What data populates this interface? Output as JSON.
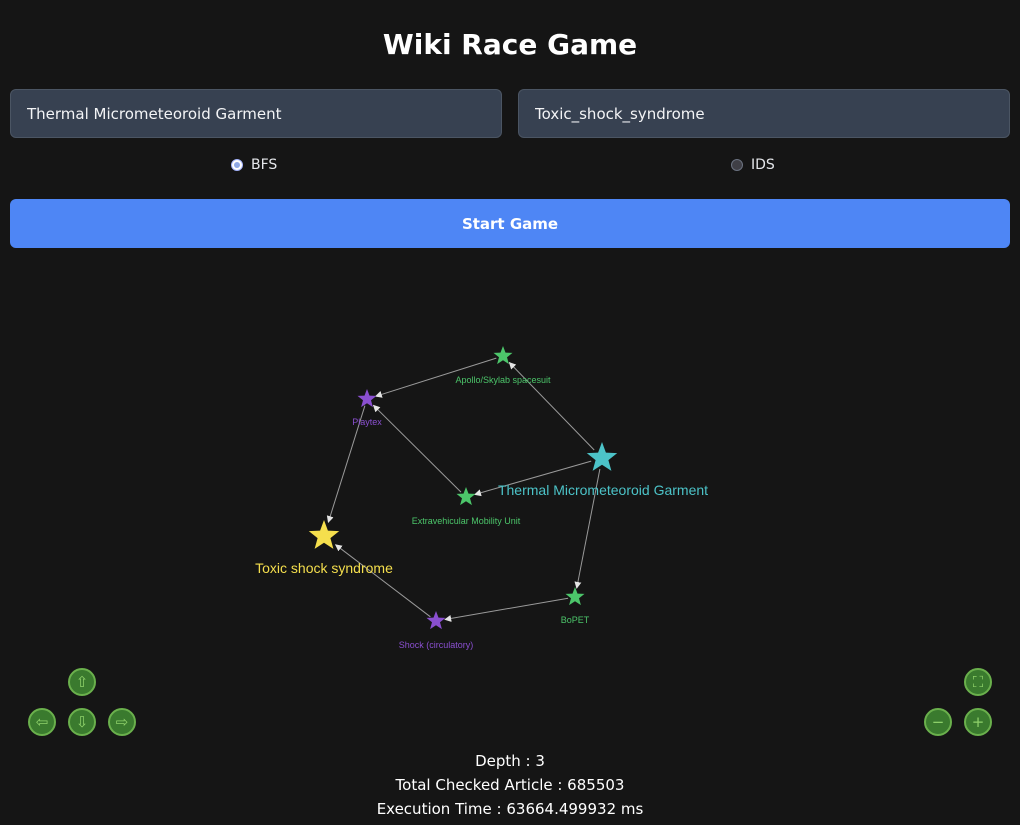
{
  "title": "Wiki Race Game",
  "inputs": {
    "start": "Thermal Micrometeoroid Garment",
    "target": "Toxic_shock_syndrome"
  },
  "algorithms": [
    {
      "label": "BFS",
      "checked": true
    },
    {
      "label": "IDS",
      "checked": false
    }
  ],
  "start_button": "Start Game",
  "graph": {
    "colors": {
      "start": "#4cc3c8",
      "target": "#f5df4d",
      "green": "#4cc56a",
      "purple": "#8a4fd0",
      "edge": "#9a9a9a"
    },
    "nodes": [
      {
        "id": "tmg",
        "label": "Thermal Micrometeoroid Garment",
        "color": "start",
        "size": "large"
      },
      {
        "id": "apollo",
        "label": "Apollo/Skylab spacesuit",
        "color": "green",
        "size": "small"
      },
      {
        "id": "playtex",
        "label": "Playtex",
        "color": "purple",
        "size": "small"
      },
      {
        "id": "emu",
        "label": "Extravehicular Mobility Unit",
        "color": "green",
        "size": "small"
      },
      {
        "id": "toxic",
        "label": "Toxic shock syndrome",
        "color": "target",
        "size": "large"
      },
      {
        "id": "bopet",
        "label": "BoPET",
        "color": "green",
        "size": "small"
      },
      {
        "id": "shock",
        "label": "Shock (circulatory)",
        "color": "purple",
        "size": "small"
      }
    ],
    "edges": [
      [
        "tmg",
        "apollo"
      ],
      [
        "apollo",
        "playtex"
      ],
      [
        "playtex",
        "toxic"
      ],
      [
        "tmg",
        "emu"
      ],
      [
        "emu",
        "playtex"
      ],
      [
        "tmg",
        "bopet"
      ],
      [
        "bopet",
        "shock"
      ],
      [
        "shock",
        "toxic"
      ]
    ]
  },
  "controls": {
    "pan_up": "up-arrow-icon",
    "pan_left": "left-arrow-icon",
    "pan_down": "down-arrow-icon",
    "pan_right": "right-arrow-icon",
    "fit": "fit-icon",
    "zoom_out": "zoom-out-icon",
    "zoom_in": "zoom-in-icon"
  },
  "stats": {
    "depth": "Depth : 3",
    "total_checked": "Total Checked Article : 685503",
    "execution_time": "Execution Time : 63664.499932 ms"
  }
}
